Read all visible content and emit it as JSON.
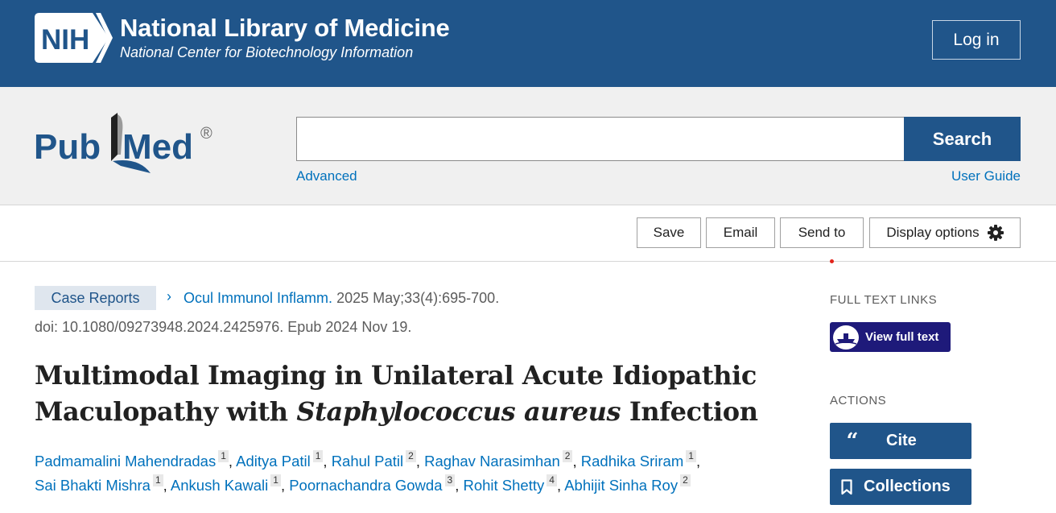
{
  "header": {
    "logo_text": "NIH",
    "org_title": "National Library of Medicine",
    "org_subtitle": "National Center for Biotechnology Information",
    "login_label": "Log in"
  },
  "search": {
    "logo_text_left": "Pub",
    "logo_text_right": "Med",
    "logo_mark": "®",
    "input_value": "",
    "button_label": "Search",
    "advanced_label": "Advanced",
    "user_guide_label": "User Guide"
  },
  "toolbar": {
    "save_label": "Save",
    "email_label": "Email",
    "send_to_label": "Send to",
    "display_options_label": "Display options",
    "display_options_icon": "gear-icon"
  },
  "article": {
    "publication_type": "Case Reports",
    "journal": "Ocul Immunol Inflamm.",
    "citation": "2025 May;33(4):695-700.",
    "doi_line": "doi: 10.1080/09273948.2024.2425976. Epub 2024 Nov 19.",
    "title_part1": "Multimodal Imaging in Unilateral Acute Idiopathic Maculopathy with ",
    "title_italic": "Staphylococcus aureus",
    "title_part2": " Infection",
    "authors": [
      {
        "name": "Padmamalini Mahendradas",
        "affiliation": "1"
      },
      {
        "name": "Aditya Patil",
        "affiliation": "1"
      },
      {
        "name": "Rahul Patil",
        "affiliation": "2"
      },
      {
        "name": "Raghav Narasimhan",
        "affiliation": "2"
      },
      {
        "name": "Radhika Sriram",
        "affiliation": "1"
      },
      {
        "name": "Sai Bhakti Mishra",
        "affiliation": "1"
      },
      {
        "name": "Ankush Kawali",
        "affiliation": "1"
      },
      {
        "name": "Poornachandra Gowda",
        "affiliation": "3"
      },
      {
        "name": "Rohit Shetty",
        "affiliation": "4"
      },
      {
        "name": "Abhijit Sinha Roy",
        "affiliation": "2"
      }
    ]
  },
  "sidebar": {
    "full_text_heading": "FULL TEXT LINKS",
    "view_full_text_label": "View full text",
    "actions_heading": "ACTIONS",
    "cite_label": "Cite",
    "cite_icon": "quote-icon",
    "collections_label": "Collections",
    "collections_icon": "bookmark-icon"
  },
  "colors": {
    "nih_blue": "#20558a",
    "link_blue": "#0071bc",
    "full_text_navy": "#1e1a7a",
    "search_bg": "#f0f0f0"
  }
}
